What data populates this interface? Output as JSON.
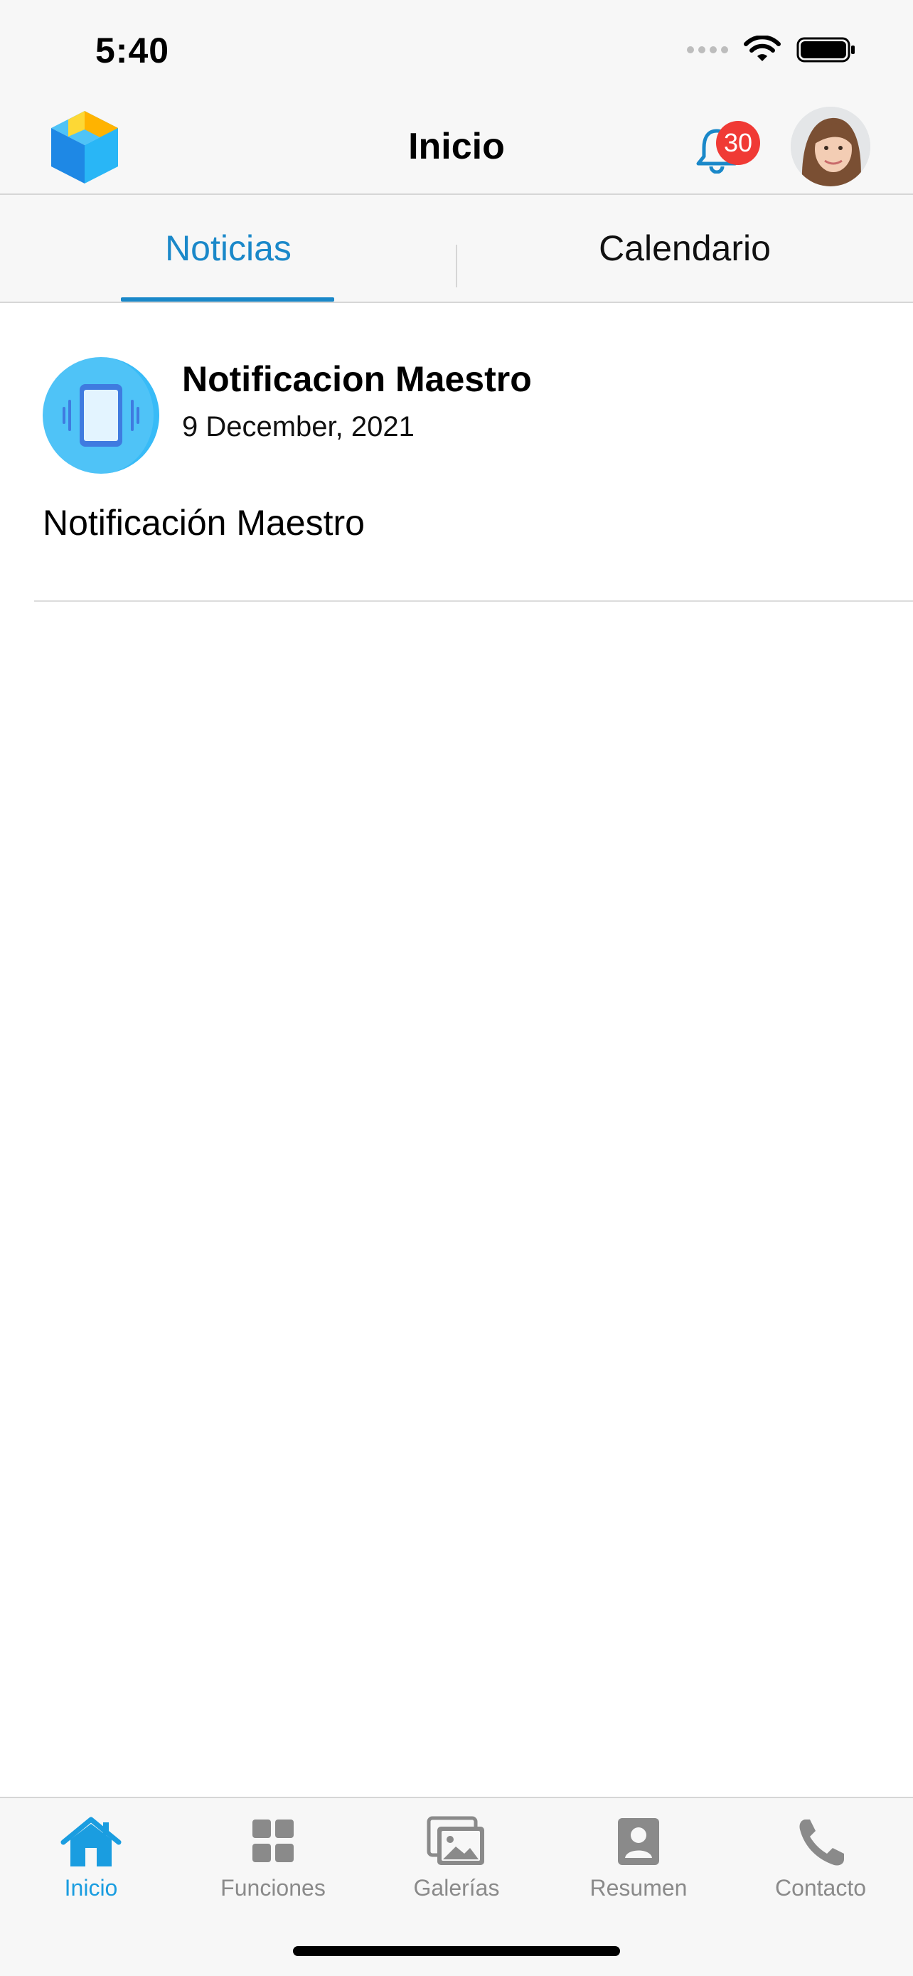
{
  "status_bar": {
    "time": "5:40"
  },
  "header": {
    "title": "Inicio",
    "notification_count": "30"
  },
  "tabs": [
    {
      "label": "Noticias",
      "active": true
    },
    {
      "label": "Calendario",
      "active": false
    }
  ],
  "news": [
    {
      "title": "Notificacion Maestro",
      "date": "9 December, 2021",
      "body": "Notificación Maestro",
      "icon": "vibrating-phone-icon"
    }
  ],
  "tabbar": {
    "items": [
      {
        "label": "Inicio",
        "icon": "home-icon",
        "active": true
      },
      {
        "label": "Funciones",
        "icon": "grid-icon",
        "active": false
      },
      {
        "label": "Galerías",
        "icon": "gallery-icon",
        "active": false
      },
      {
        "label": "Resumen",
        "icon": "profile-card-icon",
        "active": false
      },
      {
        "label": "Contacto",
        "icon": "phone-icon",
        "active": false
      }
    ]
  },
  "colors": {
    "accent": "#1a88c9",
    "tab_active": "#1a9de0",
    "badge": "#f03a35",
    "inactive": "#8a8a8a"
  }
}
